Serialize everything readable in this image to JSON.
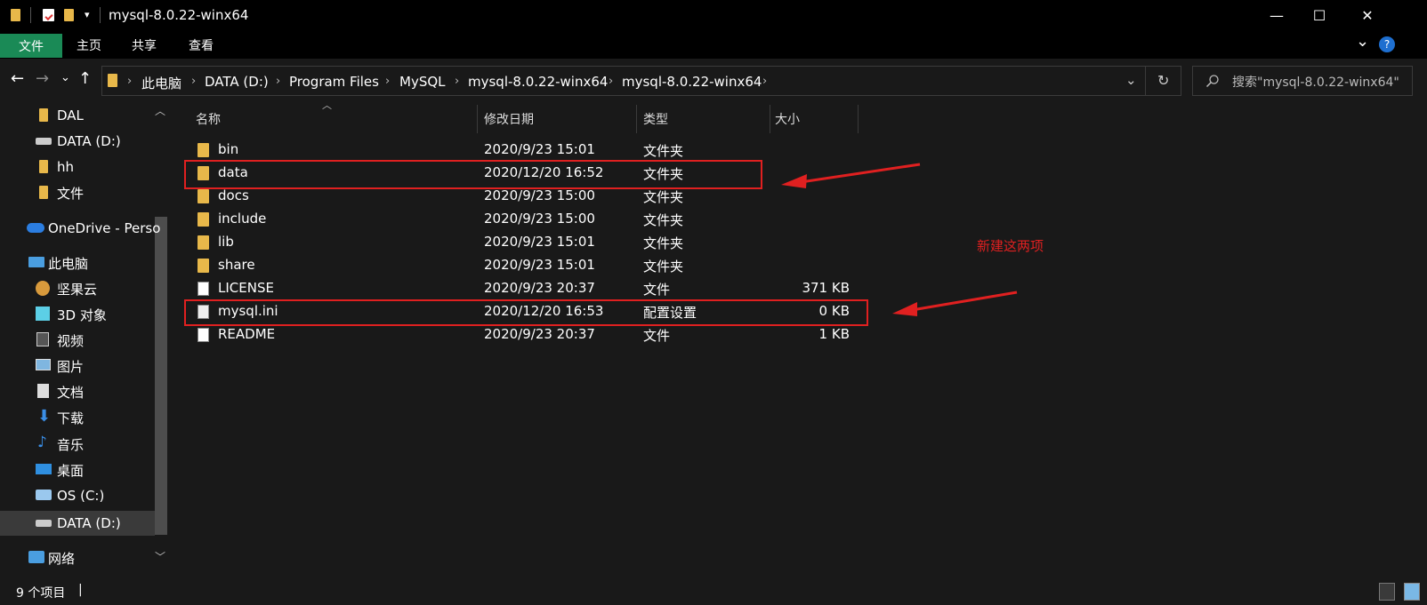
{
  "window": {
    "title": "mysql-8.0.22-winx64",
    "minimize_icon": "minimize-icon",
    "maximize_icon": "maximize-icon",
    "close_icon": "close-icon",
    "min_glyph": "—",
    "max_glyph": "☐",
    "close_glyph": "✕"
  },
  "ribbon": {
    "tabs": [
      "文件",
      "主页",
      "共享",
      "查看"
    ],
    "expand_glyph": "⌄",
    "help_glyph": "?"
  },
  "nav_buttons": {
    "back": "←",
    "forward": "→",
    "recent": "⌄",
    "up": "↑"
  },
  "address": {
    "crumbs": [
      "此电脑",
      "DATA (D:)",
      "Program Files",
      "MySQL",
      "mysql-8.0.22-winx64",
      "mysql-8.0.22-winx64"
    ],
    "separator": "›",
    "dropdown_glyph": "⌄",
    "refresh_glyph": "↻"
  },
  "search": {
    "placeholder": "搜索\"mysql-8.0.22-winx64\""
  },
  "sidebar": {
    "items": [
      {
        "label": "DAL",
        "icon": "folder-icon"
      },
      {
        "label": "DATA (D:)",
        "icon": "drive-icon"
      },
      {
        "label": "hh",
        "icon": "folder-icon"
      },
      {
        "label": "文件",
        "icon": "folder-icon"
      },
      {
        "label": "OneDrive - Perso",
        "icon": "cloud-icon"
      },
      {
        "label": "此电脑",
        "icon": "computer-icon"
      },
      {
        "label": "坚果云",
        "icon": "nut-icon"
      },
      {
        "label": "3D 对象",
        "icon": "cube-icon"
      },
      {
        "label": "视频",
        "icon": "video-icon"
      },
      {
        "label": "图片",
        "icon": "picture-icon"
      },
      {
        "label": "文档",
        "icon": "document-icon"
      },
      {
        "label": "下载",
        "icon": "download-icon"
      },
      {
        "label": "音乐",
        "icon": "music-icon"
      },
      {
        "label": "桌面",
        "icon": "desktop-icon"
      },
      {
        "label": "OS (C:)",
        "icon": "os-drive-icon"
      },
      {
        "label": "DATA (D:)",
        "icon": "drive-icon"
      },
      {
        "label": "网络",
        "icon": "network-icon"
      }
    ]
  },
  "columns": {
    "name": "名称",
    "modified": "修改日期",
    "type": "类型",
    "size": "大小"
  },
  "files": [
    {
      "name": "bin",
      "modified": "2020/9/23 15:01",
      "type": "文件夹",
      "size": "",
      "kind": "folder"
    },
    {
      "name": "data",
      "modified": "2020/12/20 16:52",
      "type": "文件夹",
      "size": "",
      "kind": "folder"
    },
    {
      "name": "docs",
      "modified": "2020/9/23 15:00",
      "type": "文件夹",
      "size": "",
      "kind": "folder"
    },
    {
      "name": "include",
      "modified": "2020/9/23 15:00",
      "type": "文件夹",
      "size": "",
      "kind": "folder"
    },
    {
      "name": "lib",
      "modified": "2020/9/23 15:01",
      "type": "文件夹",
      "size": "",
      "kind": "folder"
    },
    {
      "name": "share",
      "modified": "2020/9/23 15:01",
      "type": "文件夹",
      "size": "",
      "kind": "folder"
    },
    {
      "name": "LICENSE",
      "modified": "2020/9/23 20:37",
      "type": "文件",
      "size": "371 KB",
      "kind": "file"
    },
    {
      "name": "mysql.ini",
      "modified": "2020/12/20 16:53",
      "type": "配置设置",
      "size": "0 KB",
      "kind": "ini"
    },
    {
      "name": "README",
      "modified": "2020/9/23 20:37",
      "type": "文件",
      "size": "1 KB",
      "kind": "file"
    }
  ],
  "annotation": {
    "text": "新建这两项",
    "color": "#e02020"
  },
  "status": {
    "count": "9 个项目",
    "divider": "|"
  },
  "colors": {
    "accent": "#1a8a56",
    "folder": "#e8b84a",
    "background": "#191919"
  }
}
